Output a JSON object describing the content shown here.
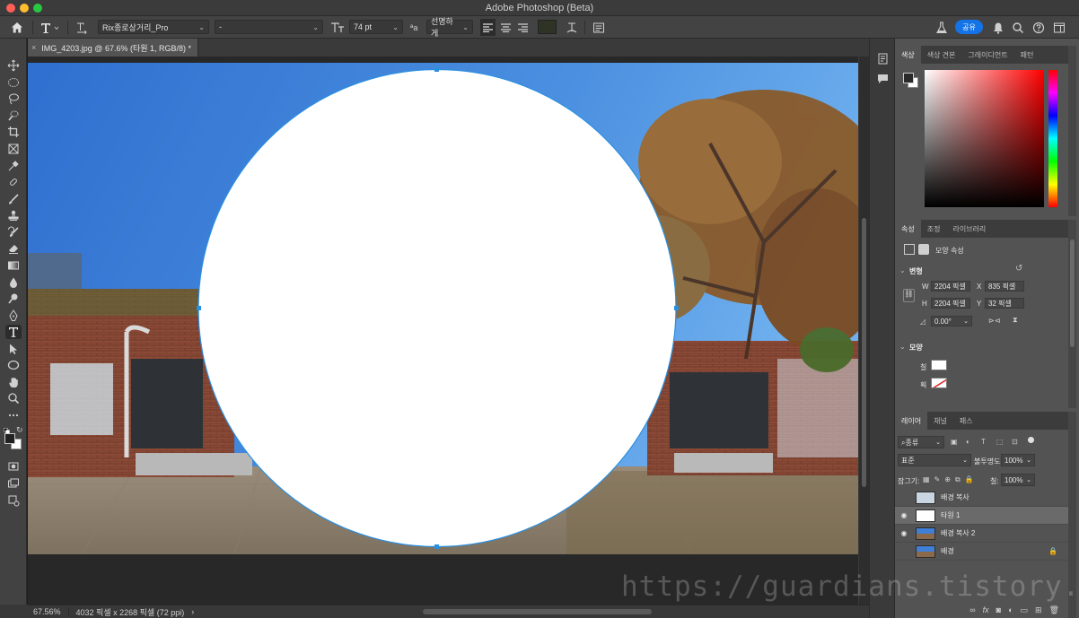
{
  "window": {
    "title": "Adobe Photoshop (Beta)"
  },
  "options_bar": {
    "font_family": "Rix종로상거리_Pro",
    "font_style": "-",
    "font_size": "74 pt",
    "antialias_glyph": "ªa",
    "antialias": "선명하게",
    "share_label": "공유"
  },
  "document": {
    "tab_title": "IMG_4203.jpg @ 67.6% (타원 1, RGB/8) *",
    "tab_close": "×"
  },
  "status": {
    "zoom": "67.56%",
    "info": "4032 픽셀 x 2268 픽셀 (72 ppi)",
    "arrow": "›"
  },
  "color_panel": {
    "tabs": [
      "색상",
      "색상 견본",
      "그레이디언트",
      "패턴"
    ],
    "hue": "#ff0000"
  },
  "properties_panel": {
    "tabs": [
      "속성",
      "조정",
      "라이브러리"
    ],
    "header": "모양 속성",
    "transform_title": "변형",
    "w_label": "W",
    "w_value": "2204 픽셀",
    "h_label": "H",
    "h_value": "2204 픽셀",
    "x_label": "X",
    "x_value": "835 픽셀",
    "y_label": "Y",
    "y_value": "32 픽셀",
    "angle_value": "0.00°",
    "shape_title": "모양",
    "fill_label": "칠",
    "stroke_label": "획"
  },
  "layers_panel": {
    "tabs": [
      "레이어",
      "채널",
      "패스"
    ],
    "filter": "종류",
    "blend_mode": "표준",
    "opacity_label": "불투명도:",
    "opacity_value": "100%",
    "lock_label": "잠그기:",
    "fill_label": "칠:",
    "fill_value": "100%",
    "layers": [
      {
        "name": "배경 복사",
        "visible": false,
        "selected": false,
        "locked": false
      },
      {
        "name": "타원 1",
        "visible": true,
        "selected": true,
        "locked": false
      },
      {
        "name": "배경 복사 2",
        "visible": true,
        "selected": false,
        "locked": false
      },
      {
        "name": "배경",
        "visible": false,
        "selected": false,
        "locked": true
      }
    ],
    "footer_fx": "fx"
  },
  "watermark": "https://guardians.tistory.com/"
}
